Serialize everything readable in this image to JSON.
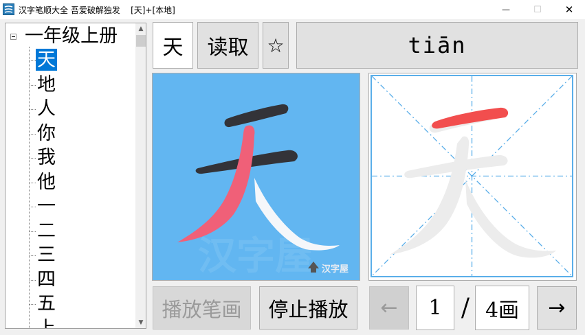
{
  "window": {
    "title": "汉字笔顺大全 吾爱破解独发    [天]+[本地]",
    "minimize_glyph": "—",
    "maximize_glyph": "☐",
    "close_glyph": "✕"
  },
  "tree": {
    "root_label": "一年级上册",
    "items": [
      "天",
      "地",
      "人",
      "你",
      "我",
      "他",
      "一",
      "二",
      "三",
      "四",
      "五",
      "上"
    ],
    "selected_index": 0
  },
  "toolbar": {
    "current_char": "天",
    "read_label": "读取",
    "star_glyph": "☆",
    "pinyin": "tiān"
  },
  "animation_panel": {
    "background_color": "#62b6f1",
    "watermark_big": "汉字屋",
    "watermark_small": "汉字屋"
  },
  "grid_panel": {
    "guide_color": "#5aaee9",
    "highlight_color": "#f24e4e"
  },
  "controls": {
    "play_label": "播放笔画",
    "stop_label": "停止播放",
    "prev_glyph": "←",
    "current_stroke": "1",
    "separator": "/",
    "total_strokes": "4画",
    "next_glyph": "→"
  }
}
